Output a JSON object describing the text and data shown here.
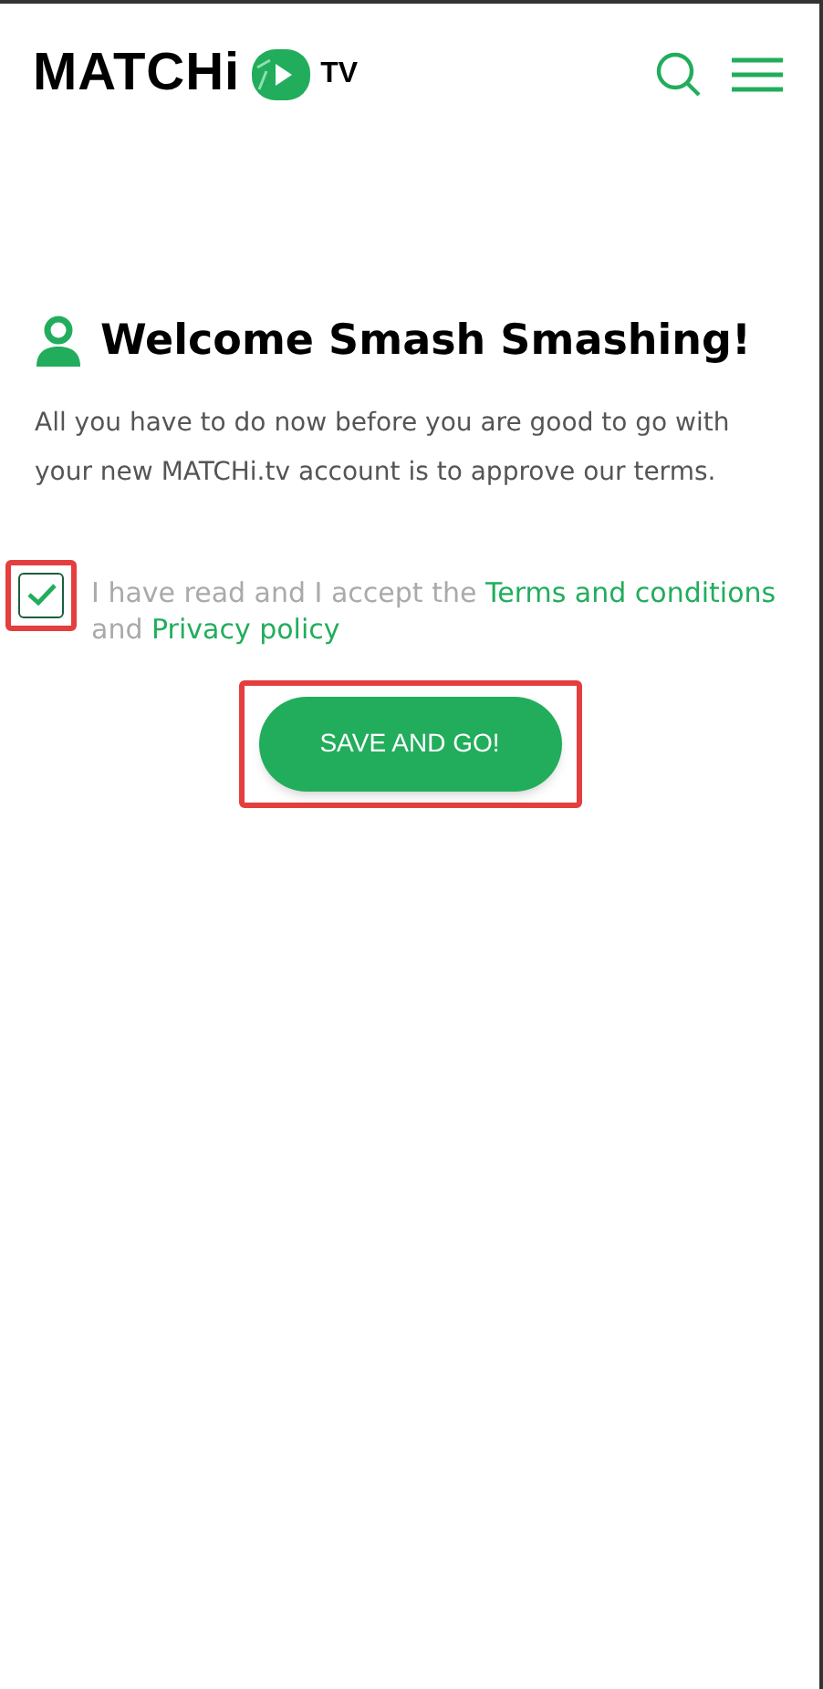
{
  "header": {
    "logo": {
      "wordmark": "MATCHi",
      "suffix": "TV"
    }
  },
  "welcome": {
    "title": "Welcome Smash Smashing!",
    "body": "All you have to do now before you are good to go with your new MATCHi.tv account is to approve our terms."
  },
  "terms": {
    "checked": true,
    "highlighted": true,
    "text_before": "I have read and I accept the",
    "link_terms": "Terms and conditions",
    "text_middle": "and",
    "link_privacy": "Privacy policy"
  },
  "save_button": {
    "label": "SAVE AND GO!",
    "highlighted": true
  }
}
